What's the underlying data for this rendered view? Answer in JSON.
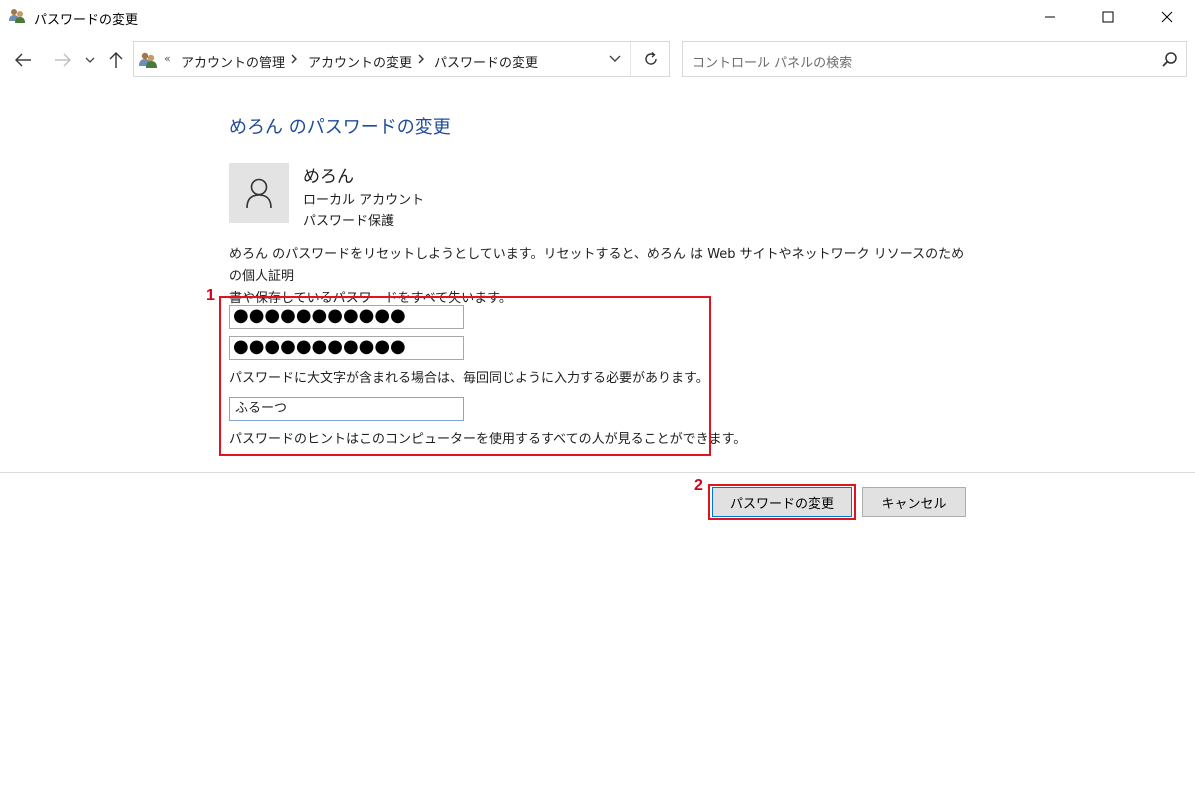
{
  "window": {
    "title": "パスワードの変更"
  },
  "address_bar": {
    "breadcrumb_prefix": "«",
    "crumbs": [
      "アカウントの管理",
      "アカウントの変更",
      "パスワードの変更"
    ]
  },
  "search": {
    "placeholder": "コントロール パネルの検索"
  },
  "page": {
    "title": "めろん のパスワードの変更",
    "user": {
      "name": "めろん",
      "account_type": "ローカル アカウント",
      "protection": "パスワード保護"
    },
    "warning_line1": "めろん のパスワードをリセットしようとしています。リセットすると、めろん は Web サイトやネットワーク リソースのための個人証明",
    "warning_line2": "書や保存しているパスワードをすべて失います。",
    "new_password_masked": "●●●●●●●●●●●",
    "confirm_password_masked": "●●●●●●●●●●●",
    "case_note": "パスワードに大文字が含まれる場合は、毎回同じように入力する必要があります。",
    "hint_value": "ふるーつ",
    "hint_note": "パスワードのヒントはこのコンピューターを使用するすべての人が見ることができます。"
  },
  "annotations": {
    "step1": "1",
    "step2": "2",
    "highlight_color": "#e0131f"
  },
  "buttons": {
    "change_password": "パスワードの変更",
    "cancel": "キャンセル"
  }
}
